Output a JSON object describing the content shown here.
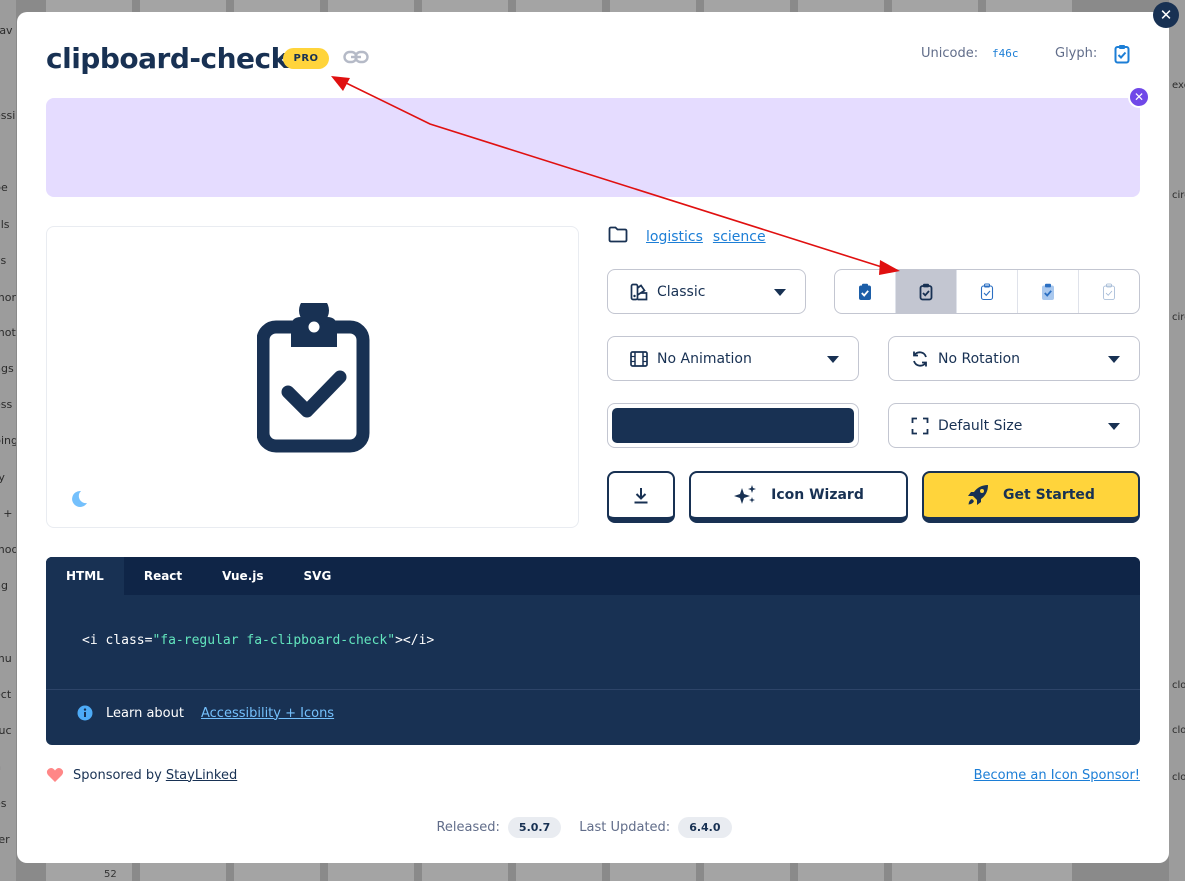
{
  "background": {
    "left_fragments": [
      "Fav",
      "s",
      "essib",
      "be",
      "als",
      "vs",
      "mor",
      "mot",
      "ngs",
      "ess",
      "ping",
      "ty",
      "s +",
      "mod",
      "ng",
      "g",
      "mu",
      "ect",
      "ruc",
      "n",
      "es",
      "ter"
    ],
    "right_fragments": [
      "exc",
      "circ",
      "circ",
      "clo",
      "clo",
      "clo"
    ],
    "bottom_number": "52"
  },
  "header": {
    "title": "clipboard-check",
    "badge": "PRO",
    "unicode_label": "Unicode:",
    "unicode_value": "f46c",
    "glyph_label": "Glyph:"
  },
  "categories": [
    "logistics",
    "science"
  ],
  "controls": {
    "family": "Classic",
    "animation": "No Animation",
    "rotation": "No Rotation",
    "size": "Default Size",
    "color": "#183153"
  },
  "style_options": [
    "solid",
    "regular",
    "light",
    "duotone",
    "thin"
  ],
  "selected_style": "regular",
  "buttons": {
    "icon_wizard": "Icon Wizard",
    "get_started": "Get Started"
  },
  "code": {
    "tabs": [
      "HTML",
      "React",
      "Vue.js",
      "SVG"
    ],
    "active_tab": "HTML",
    "snippet_open": "<i class=",
    "snippet_class": "\"fa-regular fa-clipboard-check\"",
    "snippet_close": "></i>",
    "learn_text": "Learn about",
    "learn_link": "Accessibility + Icons"
  },
  "sponsor": {
    "text": "Sponsored by",
    "name": "StayLinked",
    "become": "Become an Icon Sponsor!"
  },
  "meta": {
    "released_label": "Released:",
    "released_value": "5.0.7",
    "updated_label": "Last Updated:",
    "updated_value": "6.4.0"
  },
  "colors": {
    "navy": "#183153",
    "accent_blue": "#1c7ed6",
    "yellow": "#ffd43b",
    "ad_purple": "#e5dcff",
    "annotation_red": "#e01010"
  }
}
